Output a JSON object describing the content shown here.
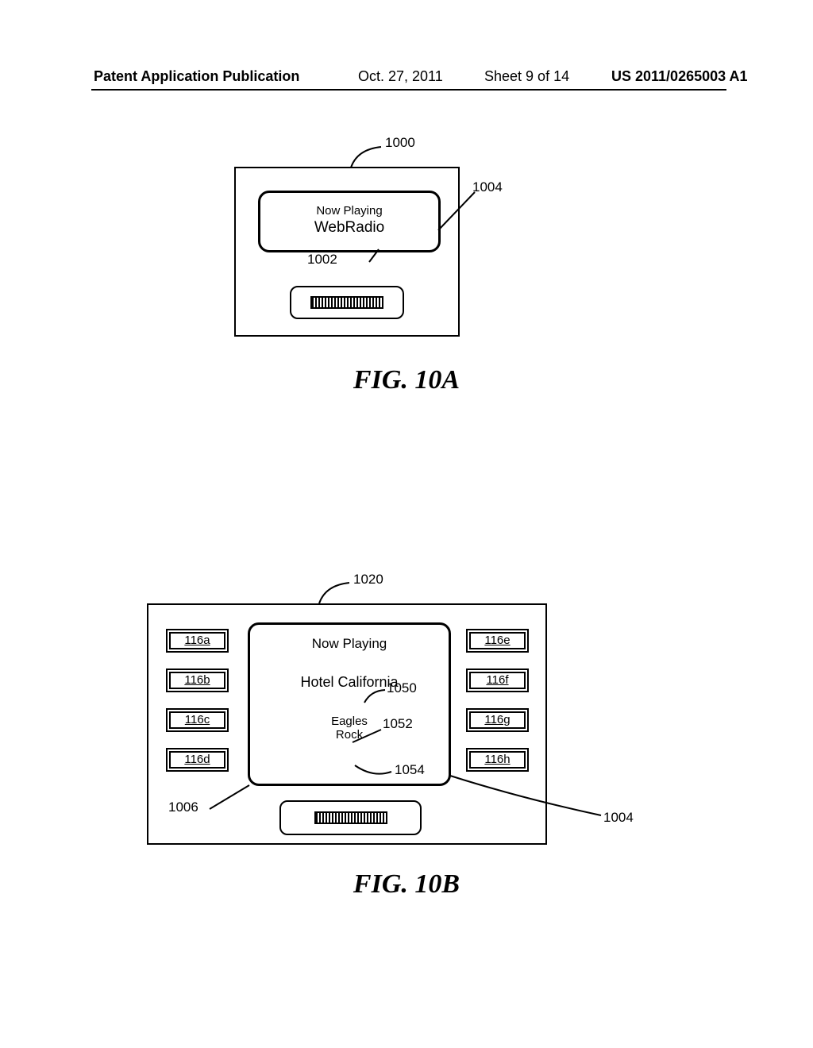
{
  "header": {
    "left": "Patent Application Publication",
    "date": "Oct. 27, 2011",
    "sheet": "Sheet 9 of 14",
    "pub": "US 2011/0265003 A1"
  },
  "figA": {
    "caption": "FIG. 10A",
    "ref_panel": "1000",
    "ref_display": "1004",
    "ref_source": "1002",
    "now_playing": "Now Playing",
    "source": "WebRadio"
  },
  "figB": {
    "caption": "FIG. 10B",
    "ref_panel": "1020",
    "ref_display": "1004",
    "ref_rounded": "1006",
    "ref_song": "1050",
    "ref_artist": "1052",
    "ref_genre": "1054",
    "now_playing": "Now Playing",
    "song": "Hotel California",
    "artist": "Eagles",
    "genre": "Rock",
    "buttons_left": [
      "116a",
      "116b",
      "116c",
      "116d"
    ],
    "buttons_right": [
      "116e",
      "116f",
      "116g",
      "116h"
    ]
  }
}
